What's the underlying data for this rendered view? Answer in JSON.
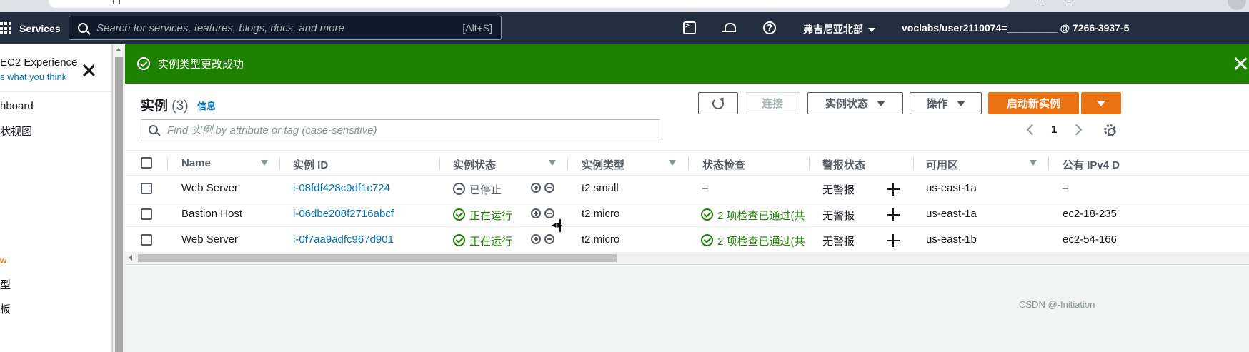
{
  "browser": {
    "url_fragment": "",
    "address_placeholder": ""
  },
  "topnav": {
    "services_label": "Services",
    "search_placeholder": "Search for services, features, blogs, docs, and more",
    "search_shortcut": "[Alt+S]",
    "region": "弗吉尼亚北部",
    "account": "voclabs/user2110074=_________ @ 7266-3937-5"
  },
  "sidebar": {
    "title": "EC2 Experience",
    "feedback_link": "s what you think",
    "items": [
      "hboard",
      "状视图"
    ],
    "new_badge": "w",
    "lower_items": [
      "型",
      "板"
    ]
  },
  "flash": {
    "message": "实例类型更改成功"
  },
  "panel": {
    "title": "实例",
    "count": "(3)",
    "info_link": "信息",
    "buttons": {
      "connect": "连接",
      "instance_state": "实例状态",
      "actions": "操作",
      "launch": "启动新实例"
    },
    "filter_placeholder": "Find 实例 by attribute or tag (case-sensitive)",
    "page": "1"
  },
  "table": {
    "columns": [
      "Name",
      "实例 ID",
      "实例状态",
      "实例类型",
      "状态检查",
      "警报状态",
      "可用区",
      "公有 IPv4 D"
    ],
    "rows": [
      {
        "name": "Web Server",
        "id": "i-08fdf428c9df1c724",
        "state": "已停止",
        "state_kind": "stopped",
        "type": "t2.small",
        "check": "–",
        "alarm": "无警报",
        "az": "us-east-1a",
        "ip": "–"
      },
      {
        "name": "Bastion Host",
        "id": "i-06dbe208f2716abcf",
        "state": "正在运行",
        "state_kind": "running",
        "type": "t2.micro",
        "check": "2 项检查已通过(共",
        "alarm": "无警报",
        "az": "us-east-1a",
        "ip": "ec2-18-235"
      },
      {
        "name": "Web Server",
        "id": "i-0f7aa9adfc967d901",
        "state": "正在运行",
        "state_kind": "running",
        "type": "t2.micro",
        "check": "2 项检查已通过(共",
        "alarm": "无警报",
        "az": "us-east-1b",
        "ip": "ec2-54-166"
      }
    ]
  },
  "watermark": "CSDN @-Initiation",
  "colors": {
    "nav_bg": "#232f3e",
    "success_green": "#1d8102",
    "link_blue": "#0073bb",
    "primary_orange": "#ec7211"
  }
}
